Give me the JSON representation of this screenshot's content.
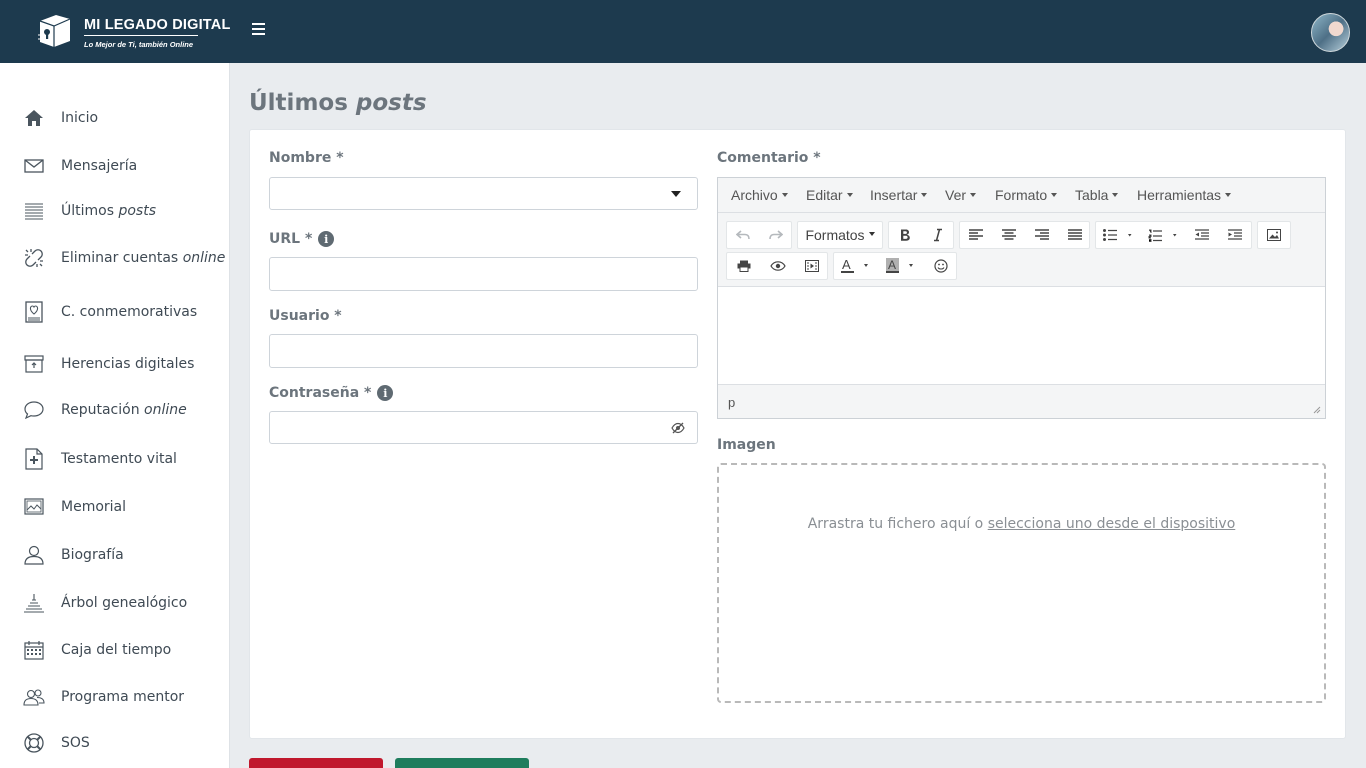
{
  "brand": {
    "title": "MI LEGADO DIGITAL",
    "tagline": "Lo Mejor de Ti, también Online",
    "header_color": "#1d3a4e"
  },
  "sidebar": {
    "items": [
      {
        "name": "inicio",
        "label": "Inicio",
        "em": "",
        "icon": "home-icon"
      },
      {
        "name": "mensajeria",
        "label": "Mensajería",
        "em": "",
        "icon": "envelope-icon"
      },
      {
        "name": "ultimos-posts",
        "label": "Últimos ",
        "em": "posts",
        "icon": "lines-icon"
      },
      {
        "name": "eliminar-cuentas",
        "label": "Eliminar cuentas ",
        "em": "online",
        "icon": "broken-link-icon"
      },
      {
        "name": "c-conmemorativas",
        "label": "C. conmemorativas",
        "em": "",
        "icon": "heart-book-icon"
      },
      {
        "name": "herencias-digitales",
        "label": "Herencias digitales",
        "em": "",
        "icon": "archive-box-icon"
      },
      {
        "name": "reputacion-online",
        "label": "Reputación ",
        "em": "online",
        "icon": "chat-bubble-icon"
      },
      {
        "name": "testamento-vital",
        "label": "Testamento vital",
        "em": "",
        "icon": "medical-file-icon"
      },
      {
        "name": "memorial",
        "label": "Memorial",
        "em": "",
        "icon": "picture-icon"
      },
      {
        "name": "biografia",
        "label": "Biografía",
        "em": "",
        "icon": "user-icon"
      },
      {
        "name": "arbol-genealogico",
        "label": "Árbol genealógico",
        "em": "",
        "icon": "tree-icon"
      },
      {
        "name": "caja-del-tiempo",
        "label": "Caja del tiempo",
        "em": "",
        "icon": "calendar-icon"
      },
      {
        "name": "programa-mentor",
        "label": "Programa mentor",
        "em": "",
        "icon": "users-icon"
      },
      {
        "name": "sos",
        "label": "SOS",
        "em": "",
        "icon": "lifebuoy-icon"
      }
    ]
  },
  "page": {
    "title": "Últimos ",
    "title_em": "posts"
  },
  "form": {
    "nombre_label": "Nombre *",
    "nombre_value": "",
    "url_label": "URL *",
    "url_value": "",
    "usuario_label": "Usuario *",
    "usuario_value": "",
    "password_label": "Contraseña *",
    "password_value": "",
    "comentario_label": "Comentario *",
    "imagen_label": "Imagen"
  },
  "editor": {
    "menu": [
      "Archivo",
      "Editar",
      "Insertar",
      "Ver",
      "Formato",
      "Tabla",
      "Herramientas"
    ],
    "formats_label": "Formatos",
    "status_path": "p"
  },
  "dropzone": {
    "text": "Arrastra tu fichero aquí o ",
    "link": "selecciona uno desde el dispositivo"
  },
  "colors": {
    "danger": "#c0182d",
    "success": "#1e7d5d"
  }
}
